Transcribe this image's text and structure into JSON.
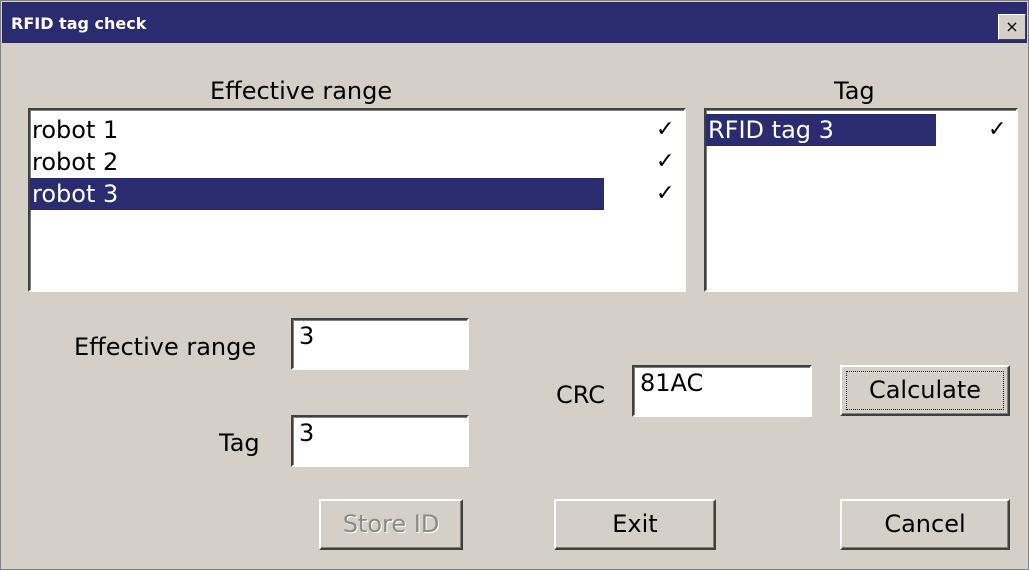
{
  "window": {
    "title": "RFID tag check",
    "close_glyph": "×"
  },
  "range_list": {
    "header": "Effective range",
    "items": [
      {
        "label": "robot 1",
        "checked": true,
        "selected": false
      },
      {
        "label": "robot 2",
        "checked": true,
        "selected": false
      },
      {
        "label": "robot 3",
        "checked": true,
        "selected": true
      }
    ]
  },
  "tag_list": {
    "header": "Tag",
    "items": [
      {
        "label": "RFID tag 3",
        "checked": true,
        "selected": true
      }
    ]
  },
  "check_glyph": "✓",
  "form": {
    "effective_range_label": "Effective range",
    "effective_range_value": "3",
    "tag_label": "Tag",
    "tag_value": "3",
    "crc_label": "CRC",
    "crc_value": "81AC"
  },
  "buttons": {
    "calculate": "Calculate",
    "store_id": "Store ID",
    "exit": "Exit",
    "cancel": "Cancel"
  },
  "colors": {
    "selection": "#2b2b6f",
    "dialog_bg": "#d4d0c8"
  }
}
